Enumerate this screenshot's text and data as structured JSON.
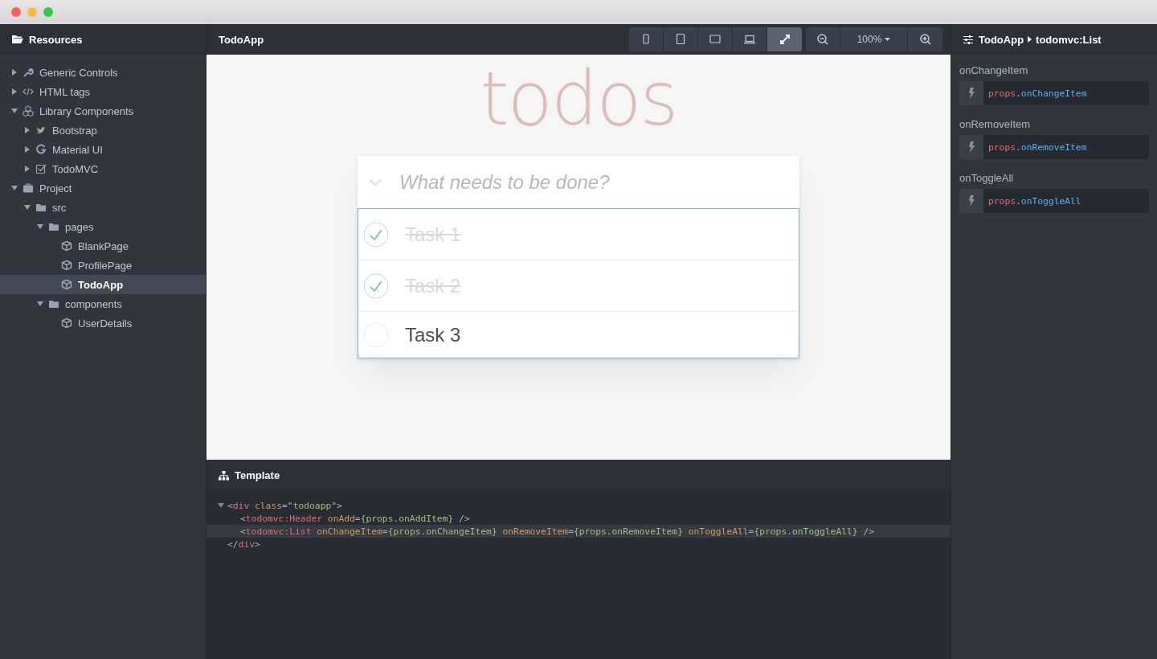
{
  "sidebar": {
    "title": "Resources",
    "tree": [
      {
        "label": "Generic Controls",
        "kind": "wrench",
        "expanded": false,
        "selected": false
      },
      {
        "label": "HTML tags",
        "kind": "code",
        "expanded": false,
        "selected": false
      },
      {
        "label": "Library Components",
        "kind": "cubes",
        "expanded": true,
        "selected": false,
        "children": [
          {
            "label": "Bootstrap",
            "kind": "bird",
            "expanded": false,
            "selected": false
          },
          {
            "label": "Material UI",
            "kind": "letter",
            "expanded": false,
            "selected": false
          },
          {
            "label": "TodoMVC",
            "kind": "checkbox",
            "expanded": false,
            "selected": false
          }
        ]
      },
      {
        "label": "Project",
        "kind": "briefcase",
        "expanded": true,
        "selected": false,
        "children": [
          {
            "label": "src",
            "kind": "folder",
            "expanded": true,
            "selected": false,
            "children": [
              {
                "label": "pages",
                "kind": "folder",
                "expanded": true,
                "selected": false,
                "children": [
                  {
                    "label": "BlankPage",
                    "kind": "component",
                    "selected": false
                  },
                  {
                    "label": "ProfilePage",
                    "kind": "component",
                    "selected": false
                  },
                  {
                    "label": "TodoApp",
                    "kind": "component",
                    "selected": true
                  }
                ]
              },
              {
                "label": "components",
                "kind": "folder",
                "expanded": true,
                "selected": false,
                "children": [
                  {
                    "label": "UserDetails",
                    "kind": "component",
                    "selected": false
                  }
                ]
              }
            ]
          }
        ]
      }
    ]
  },
  "canvas": {
    "title": "TodoApp",
    "devices": [
      {
        "kind": "phone",
        "selected": false
      },
      {
        "kind": "tablet",
        "selected": false
      },
      {
        "kind": "tablet-landscape",
        "selected": false
      },
      {
        "kind": "laptop",
        "selected": false
      },
      {
        "kind": "fullscreen",
        "selected": true
      }
    ],
    "zoom": "100%",
    "todo": {
      "title": "todos",
      "placeholder": "What needs to be done?",
      "items": [
        {
          "text": "Task 1",
          "completed": true
        },
        {
          "text": "Task 2",
          "completed": true
        },
        {
          "text": "Task 3",
          "completed": false
        }
      ]
    }
  },
  "template": {
    "title": "Template",
    "lines": [
      {
        "expanded": true,
        "highlighted": false,
        "tokens": [
          {
            "kind": "punct",
            "text": "<"
          },
          {
            "kind": "tag",
            "text": "div"
          },
          {
            "kind": "attr",
            "text": " class"
          },
          {
            "kind": "punct",
            "text": "="
          },
          {
            "kind": "value",
            "text": "\"todoapp\""
          },
          {
            "kind": "punct",
            "text": ">"
          }
        ],
        "children": [
          {
            "highlighted": false,
            "tokens": [
              {
                "kind": "punct",
                "text": "<"
              },
              {
                "kind": "tag",
                "text": "todomvc:Header"
              },
              {
                "kind": "attr",
                "text": " onAdd"
              },
              {
                "kind": "punct",
                "text": "="
              },
              {
                "kind": "value",
                "text": "{props.onAddItem}"
              },
              {
                "kind": "punct",
                "text": " />"
              }
            ]
          },
          {
            "highlighted": true,
            "tokens": [
              {
                "kind": "punct",
                "text": "<"
              },
              {
                "kind": "tag",
                "text": "todomvc:List"
              },
              {
                "kind": "attr",
                "text": " onChangeItem"
              },
              {
                "kind": "punct",
                "text": "="
              },
              {
                "kind": "value",
                "text": "{props.onChangeItem}"
              },
              {
                "kind": "attr",
                "text": " onRemoveItem"
              },
              {
                "kind": "punct",
                "text": "="
              },
              {
                "kind": "value",
                "text": "{props.onRemoveItem}"
              },
              {
                "kind": "attr",
                "text": " onToggleAll"
              },
              {
                "kind": "punct",
                "text": "="
              },
              {
                "kind": "value",
                "text": "{props.onToggleAll}"
              },
              {
                "kind": "punct",
                "text": " />"
              }
            ]
          }
        ]
      },
      {
        "highlighted": false,
        "tokens": [
          {
            "kind": "punct",
            "text": "</"
          },
          {
            "kind": "tag",
            "text": "div"
          },
          {
            "kind": "punct",
            "text": ">"
          }
        ]
      }
    ]
  },
  "inspector": {
    "breadcrumb": [
      "TodoApp",
      "todomvc:List"
    ],
    "props": [
      {
        "label": "onChangeItem",
        "value": [
          {
            "kind": "tag",
            "text": "props"
          },
          {
            "kind": "punct",
            "text": "."
          },
          {
            "kind": "name",
            "text": "onChangeItem"
          }
        ]
      },
      {
        "label": "onRemoveItem",
        "value": [
          {
            "kind": "tag",
            "text": "props"
          },
          {
            "kind": "punct",
            "text": "."
          },
          {
            "kind": "name",
            "text": "onRemoveItem"
          }
        ]
      },
      {
        "label": "onToggleAll",
        "value": [
          {
            "kind": "tag",
            "text": "props"
          },
          {
            "kind": "punct",
            "text": "."
          },
          {
            "kind": "name",
            "text": "onToggleAll"
          }
        ]
      }
    ]
  }
}
